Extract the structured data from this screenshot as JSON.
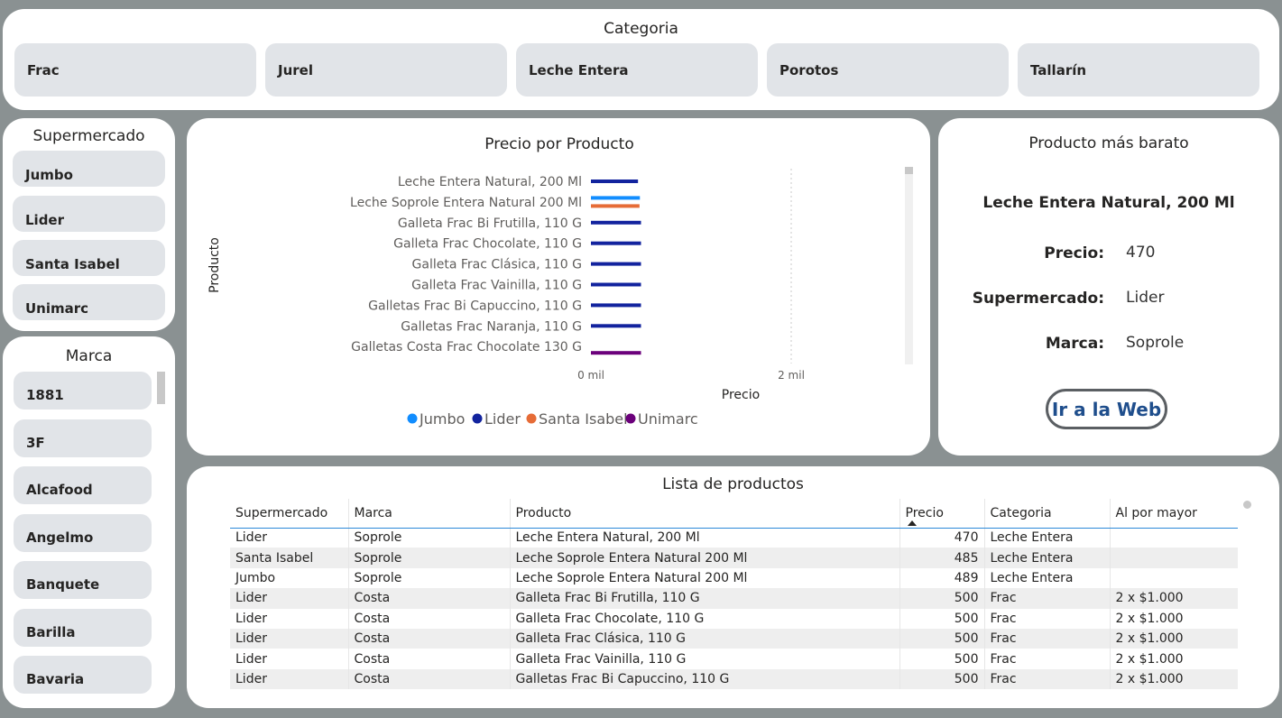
{
  "categoria": {
    "title": "Categoria",
    "items": [
      "Frac",
      "Jurel",
      "Leche Entera",
      "Porotos",
      "Tallarín"
    ]
  },
  "supermercado": {
    "title": "Supermercado",
    "items": [
      "Jumbo",
      "Lider",
      "Santa Isabel",
      "Unimarc"
    ]
  },
  "marca": {
    "title": "Marca",
    "items": [
      "1881",
      "3F",
      "Alcafood",
      "Angelmo",
      "Banquete",
      "Barilla",
      "Bavaria"
    ]
  },
  "chart_data": {
    "type": "bar",
    "orientation": "horizontal",
    "title": "Precio por Producto",
    "xlabel": "Precio",
    "ylabel": "Producto",
    "xlim": [
      0,
      2200
    ],
    "x_ticks": [
      "0 mil",
      "2 mil"
    ],
    "categories": [
      "Leche Entera Natural, 200 Ml",
      "Leche Soprole Entera Natural 200 Ml",
      "Galleta Frac Bi Frutilla, 110 G",
      "Galleta Frac Chocolate, 110 G",
      "Galleta Frac Clásica, 110 G",
      "Galleta Frac Vainilla, 110 G",
      "Galletas Frac Bi Capuccino, 110 G",
      "Galletas Frac Naranja, 110 G",
      "Galletas Costa Frac Chocolate 130 G"
    ],
    "series": [
      {
        "name": "Jumbo",
        "color": "#118dff",
        "values": [
          null,
          489,
          null,
          null,
          null,
          null,
          null,
          null,
          null
        ]
      },
      {
        "name": "Lider",
        "color": "#12239e",
        "values": [
          470,
          null,
          500,
          500,
          500,
          500,
          500,
          500,
          null
        ]
      },
      {
        "name": "Santa Isabel",
        "color": "#e66c37",
        "values": [
          null,
          485,
          null,
          null,
          null,
          null,
          null,
          null,
          null
        ]
      },
      {
        "name": "Unimarc",
        "color": "#6b007b",
        "values": [
          null,
          null,
          null,
          null,
          null,
          null,
          null,
          null,
          500
        ]
      }
    ],
    "legend_position": "bottom"
  },
  "cheapest": {
    "title": "Producto más barato",
    "product": "Leche Entera Natural, 200 Ml",
    "precio_label": "Precio:",
    "precio_value": "470",
    "super_label": "Supermercado:",
    "super_value": "Lider",
    "marca_label": "Marca:",
    "marca_value": "Soprole",
    "button": "Ir a la Web"
  },
  "lista": {
    "title": "Lista de productos",
    "columns": [
      "Supermercado",
      "Marca",
      "Producto",
      "Precio",
      "Categoria",
      "Al por mayor"
    ],
    "rows": [
      [
        "Lider",
        "Soprole",
        "Leche Entera Natural, 200 Ml",
        "470",
        "Leche Entera",
        ""
      ],
      [
        "Santa Isabel",
        "Soprole",
        "Leche Soprole Entera Natural 200 Ml",
        "485",
        "Leche Entera",
        ""
      ],
      [
        "Jumbo",
        "Soprole",
        "Leche Soprole Entera Natural 200 Ml",
        "489",
        "Leche Entera",
        ""
      ],
      [
        "Lider",
        "Costa",
        "Galleta Frac Bi Frutilla, 110 G",
        "500",
        "Frac",
        "2 x $1.000"
      ],
      [
        "Lider",
        "Costa",
        "Galleta Frac Chocolate, 110 G",
        "500",
        "Frac",
        "2 x $1.000"
      ],
      [
        "Lider",
        "Costa",
        "Galleta Frac Clásica, 110 G",
        "500",
        "Frac",
        "2 x $1.000"
      ],
      [
        "Lider",
        "Costa",
        "Galleta Frac Vainilla, 110 G",
        "500",
        "Frac",
        "2 x $1.000"
      ],
      [
        "Lider",
        "Costa",
        "Galletas Frac Bi Capuccino, 110 G",
        "500",
        "Frac",
        "2 x $1.000"
      ]
    ]
  }
}
